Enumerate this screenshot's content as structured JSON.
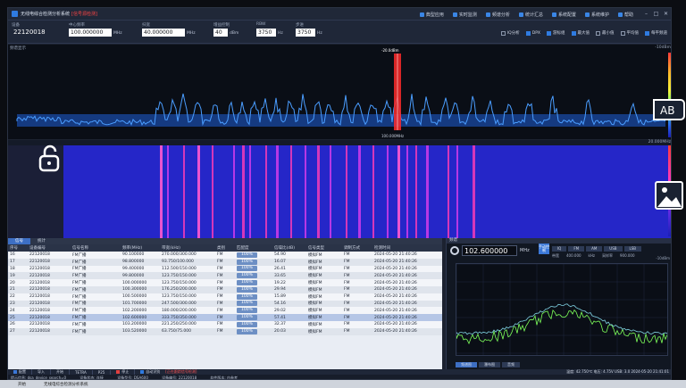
{
  "app": {
    "title": "无线电综合检测分析系统",
    "warning": "[信号源检测]"
  },
  "top_menu": [
    "典型应用",
    "实时监测",
    "频谱分析",
    "统计汇总",
    "系统配置",
    "系统维护",
    "帮助"
  ],
  "params": {
    "device": {
      "label": "设备",
      "value": "22120018"
    },
    "center_freq": {
      "label": "中心频率",
      "value": "100.000000",
      "unit": "MHz"
    },
    "span": {
      "label": "扫宽",
      "value": "40.000000",
      "unit": "MHz"
    },
    "ref_level": {
      "label": "增益控制",
      "value": "40",
      "unit": "dBm"
    },
    "rbw": {
      "label": "RBW",
      "value": "3750",
      "unit": "Hz"
    },
    "step": {
      "label": "步进",
      "value": "3750",
      "unit": "Hz"
    }
  },
  "options": [
    {
      "label": "IQ分析",
      "checked": false
    },
    {
      "label": "DPX",
      "checked": true
    },
    {
      "label": "游标组",
      "checked": true
    },
    {
      "label": "最大值",
      "checked": true
    },
    {
      "label": "最小值",
      "checked": false
    },
    {
      "label": "平均值",
      "checked": false
    },
    {
      "label": "每平频道",
      "checked": true
    }
  ],
  "spectrum": {
    "panel_label": "频谱显示",
    "marker_label": "-20.0dBm",
    "scale_top": "-10dBm",
    "center_freq_label": "100.000MHz"
  },
  "waterfall": {
    "scale_top": "20.000MHz"
  },
  "table": {
    "tabs": [
      "信号",
      "统计"
    ],
    "columns": [
      "序号",
      "设备编号",
      "信号名称",
      "频率(MHz)",
      "带宽(kHz)",
      "类别",
      "匹配度",
      "信噪比(dB)",
      "信号类型",
      "调制方式",
      "检测时间"
    ],
    "rows": [
      [
        "16",
        "22120018",
        "FM广播",
        "90.100000",
        "270.000/300.000",
        "FM",
        "100%",
        "54.90",
        "模拟FM",
        "FM",
        "2024-05-20 21:40:26"
      ],
      [
        "17",
        "22120018",
        "FM广播",
        "98.800000",
        "93.750/100.000",
        "FM",
        "100%",
        "16.07",
        "模拟FM",
        "FM",
        "2024-05-20 21:40:26"
      ],
      [
        "18",
        "22120018",
        "FM广播",
        "99.400000",
        "112.500/150.000",
        "FM",
        "100%",
        "26.41",
        "模拟FM",
        "FM",
        "2024-05-20 21:40:26"
      ],
      [
        "19",
        "22120018",
        "FM广播",
        "99.800000",
        "123.750/150.000",
        "FM",
        "100%",
        "33.65",
        "模拟FM",
        "FM",
        "2024-05-20 21:40:26"
      ],
      [
        "20",
        "22120018",
        "FM广播",
        "100.000000",
        "123.750/150.000",
        "FM",
        "100%",
        "19.22",
        "模拟FM",
        "FM",
        "2024-05-20 21:40:26"
      ],
      [
        "21",
        "22120018",
        "FM广播",
        "100.300000",
        "176.250/200.000",
        "FM",
        "100%",
        "29.94",
        "模拟FM",
        "FM",
        "2024-05-20 21:40:26"
      ],
      [
        "22",
        "22120018",
        "FM广播",
        "100.500000",
        "123.750/150.000",
        "FM",
        "100%",
        "15.89",
        "模拟FM",
        "FM",
        "2024-05-20 21:40:26"
      ],
      [
        "23",
        "22120018",
        "FM广播",
        "101.700000",
        "247.500/300.000",
        "FM",
        "100%",
        "54.16",
        "模拟FM",
        "FM",
        "2024-05-20 21:40:26"
      ],
      [
        "24",
        "22120018",
        "FM广播",
        "102.200000",
        "180.000/200.000",
        "FM",
        "100%",
        "29.02",
        "模拟FM",
        "FM",
        "2024-05-20 21:40:26"
      ],
      [
        "25",
        "22120018",
        "FM广播",
        "102.600000",
        "333.750/350.000",
        "FM",
        "100%",
        "57.41",
        "模拟FM",
        "FM",
        "2024-05-20 21:40:26"
      ],
      [
        "26",
        "22120018",
        "FM广播",
        "103.200000",
        "221.250/250.000",
        "FM",
        "100%",
        "32.37",
        "模拟FM",
        "FM",
        "2024-05-20 21:40:26"
      ],
      [
        "27",
        "22120018",
        "FM广播",
        "103.520000",
        "63.750/75.000",
        "FM",
        "100%",
        "20.03",
        "模拟FM",
        "FM",
        "2024-05-20 21:40:26"
      ]
    ],
    "selected_index": 9
  },
  "zoom": {
    "title": "频谱",
    "freq": "102.600000",
    "unit": "MHz",
    "mode": "手动控制",
    "modes": [
      "IQ",
      "FM",
      "AM",
      "USB",
      "LSB"
    ],
    "sub": [
      "带宽",
      "400.000",
      "kHz",
      "采样率",
      "900.000"
    ],
    "scale": "-10dBm",
    "bottom_tabs": [
      "频谱图",
      "瀑布图",
      "音频"
    ]
  },
  "toolbar": {
    "buttons": [
      "配置",
      "导入",
      "开始",
      "TETRA",
      "P25",
      "停止"
    ],
    "auto_check": "自动识别",
    "alert": "[正在跟踪信号检测]",
    "right_status": "温度: 42.750℃  电压: 4.75V  USB: 3.0  2024-05-20 21:41:01"
  },
  "statusbar": {
    "items": [
      "提示信息: dsa_device_search=0",
      "设备状态: 连接",
      "设备型号: DSA600",
      "设备编号: 22120018",
      "软件版本: 内参考"
    ]
  },
  "taskbar": {
    "items": [
      "开始",
      "无线电综合检测分析系统"
    ]
  },
  "colors": {
    "spectrum_trace": "#4a9dff",
    "waterfall_bg": "#2526c8",
    "signal_hot": "#ff3ad6",
    "zoom_trace": "#7dff5a",
    "zoom_max": "#7fd0e0"
  },
  "chart_data": {
    "type": "line",
    "series": [
      {
        "values": [
          0,
          0
        ]
      }
    ]
  }
}
